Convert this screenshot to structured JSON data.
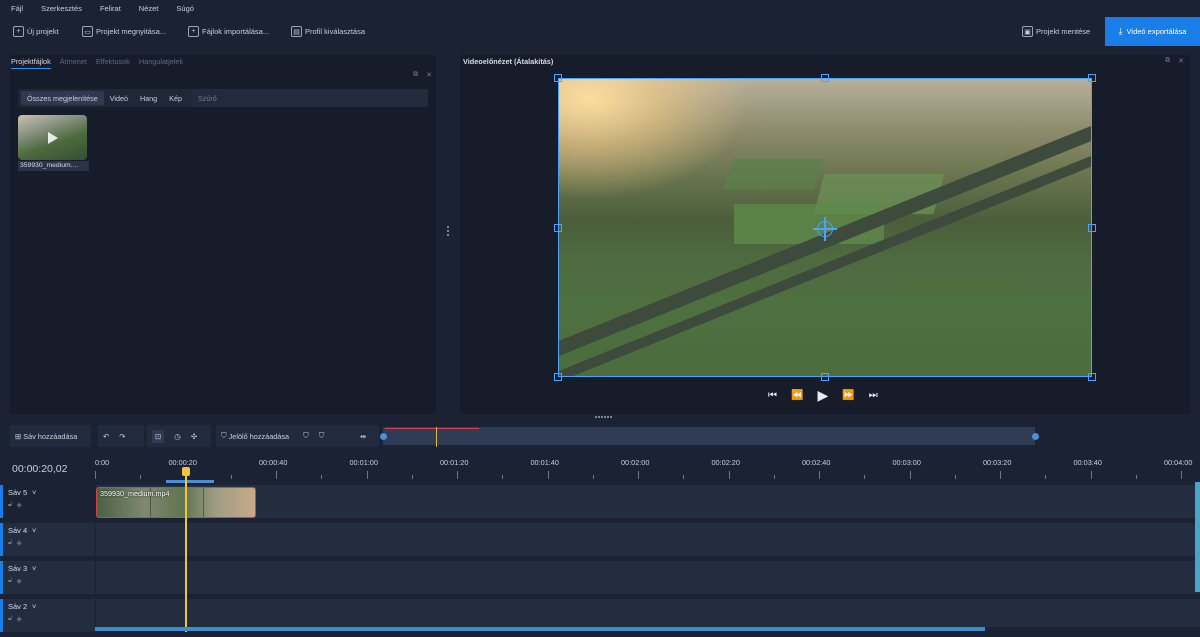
{
  "menu": [
    "Fájl",
    "Szerkesztés",
    "Felirat",
    "Nézet",
    "Súgó"
  ],
  "toolbar": {
    "new_project": "Új projekt",
    "open_project": "Projekt megnyitása...",
    "import_files": "Fájlok importálása...",
    "select_profile": "Profil kiválasztása",
    "save_project": "Projekt mentése",
    "export_video": "Videó exportálása"
  },
  "left_panel": {
    "tabs": [
      "Projektfájlok",
      "Átmenet",
      "Effektusok",
      "Hangulatjelek"
    ],
    "active_tab": 0,
    "filters": [
      "Összes megjelenítése",
      "Videó",
      "Hang",
      "Kép"
    ],
    "active_filter": 0,
    "filter_placeholder": "Szűrő",
    "file_name": "359930_medium...."
  },
  "preview": {
    "title": "Videoelőnézet (Átalakítás)"
  },
  "timeline": {
    "add_track": "Sáv hozzáadása",
    "add_marker": "Jelölő hozzáadása",
    "current_time": "00:00:20,02",
    "ruler_labels": [
      "0:00",
      "00:00:20",
      "00:00:40",
      "00:01:00",
      "00:01:20",
      "00:01:40",
      "00:02:00",
      "00:02:20",
      "00:02:40",
      "00:03:00",
      "00:03:20",
      "00:03:40",
      "00:04:00"
    ],
    "tracks": [
      {
        "name": "Sáv 5"
      },
      {
        "name": "Sáv 4"
      },
      {
        "name": "Sáv 3"
      },
      {
        "name": "Sáv 2"
      }
    ],
    "clip_label": "359930_medium.mp4"
  },
  "colors": {
    "accent": "#1a7ee8",
    "playhead": "#f2c43a",
    "clip_border": "#d8424a"
  }
}
